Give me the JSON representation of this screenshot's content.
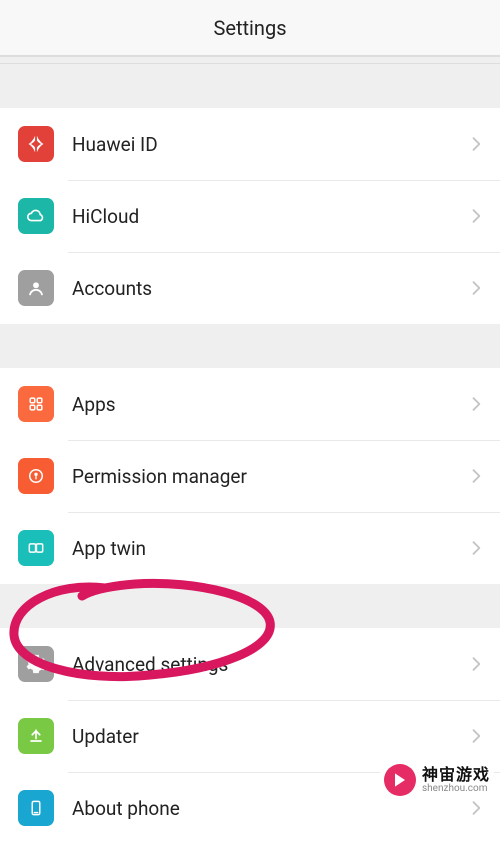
{
  "header": {
    "title": "Settings"
  },
  "groups": [
    {
      "items": [
        {
          "label": "Huawei ID",
          "icon": "huawei-logo-icon",
          "color": "#e2413a"
        },
        {
          "label": "HiCloud",
          "icon": "cloud-icon",
          "color": "#1db7a7"
        },
        {
          "label": "Accounts",
          "icon": "contact-icon",
          "color": "#9f9f9f"
        }
      ]
    },
    {
      "items": [
        {
          "label": "Apps",
          "icon": "apps-grid-icon",
          "color": "#fb6a3f"
        },
        {
          "label": "Permission manager",
          "icon": "permission-icon",
          "color": "#f85c33"
        },
        {
          "label": "App twin",
          "icon": "app-twin-icon",
          "color": "#1abfb9"
        }
      ]
    },
    {
      "items": [
        {
          "label": "Advanced settings",
          "icon": "gear-icon",
          "color": "#9f9f9f"
        },
        {
          "label": "Updater",
          "icon": "updater-icon",
          "color": "#7ac945"
        },
        {
          "label": "About phone",
          "icon": "phone-icon",
          "color": "#19a6d0"
        }
      ]
    }
  ],
  "annotation": {
    "type": "freehand-circle",
    "color": "#d9175f",
    "target_label": "Advanced settings"
  },
  "watermark": {
    "brand": "神宙游戏",
    "domain": "shenzhou.com"
  }
}
